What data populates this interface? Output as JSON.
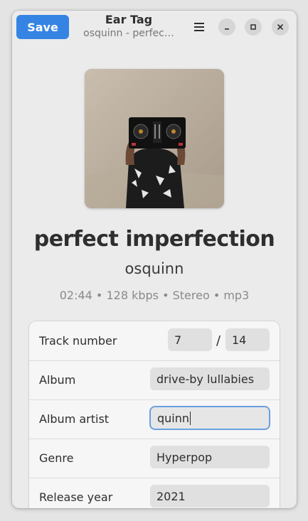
{
  "window": {
    "title": "Ear Tag",
    "subtitle": "osquinn - perfec…"
  },
  "header": {
    "save_label": "Save",
    "menu_icon": "hamburger-menu-icon",
    "minimize_icon": "minimize-icon",
    "maximize_icon": "maximize-icon",
    "close_icon": "close-icon"
  },
  "song": {
    "cover_alt": "album-cover",
    "title": "perfect imperfection",
    "artist": "osquinn",
    "meta": "02:44 • 128 kbps • Stereo • mp3"
  },
  "fields": {
    "track_number": {
      "label": "Track number",
      "value": "7",
      "separator": "/",
      "total": "14"
    },
    "album": {
      "label": "Album",
      "value": "drive-by lullabies"
    },
    "album_artist": {
      "label": "Album artist",
      "value": "quinn"
    },
    "genre": {
      "label": "Genre",
      "value": "Hyperpop"
    },
    "release_year": {
      "label": "Release year",
      "value": "2021"
    }
  },
  "colors": {
    "accent": "#3584e4",
    "focus_ring": "#6a9fe0"
  }
}
